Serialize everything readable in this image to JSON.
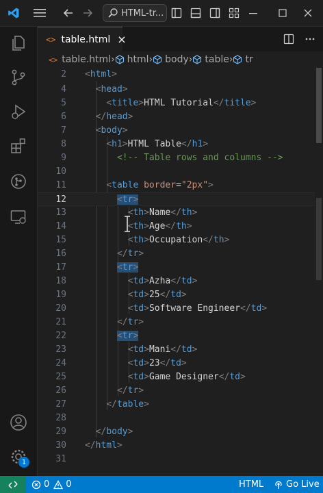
{
  "titlebar": {
    "search_text": "HTML-tr..."
  },
  "tab": {
    "label": "table.html",
    "close": "×"
  },
  "breadcrumbs": [
    "table.html",
    "html",
    "body",
    "table",
    "tr"
  ],
  "code_lines": [
    {
      "n": "2"
    },
    {
      "n": "4"
    },
    {
      "n": "5"
    },
    {
      "n": "6"
    },
    {
      "n": "7"
    },
    {
      "n": "8"
    },
    {
      "n": "9"
    },
    {
      "n": "10"
    },
    {
      "n": "11"
    },
    {
      "n": "12"
    },
    {
      "n": "13"
    },
    {
      "n": "14"
    },
    {
      "n": "15"
    },
    {
      "n": "16"
    },
    {
      "n": "17"
    },
    {
      "n": "18"
    },
    {
      "n": "19"
    },
    {
      "n": "20"
    },
    {
      "n": "21"
    },
    {
      "n": "22"
    },
    {
      "n": "23"
    },
    {
      "n": "24"
    },
    {
      "n": "25"
    },
    {
      "n": "26"
    },
    {
      "n": "27"
    },
    {
      "n": "28"
    },
    {
      "n": "29"
    },
    {
      "n": "30"
    },
    {
      "n": "31"
    }
  ],
  "code": {
    "title_text": "HTML Tutorial",
    "h1_text": "HTML Table",
    "comment": "<!-- Table rows and columns -->",
    "border_attr": "border",
    "border_val": "\"2px\"",
    "th": [
      "Name",
      "Age",
      "Occupation"
    ],
    "row1": [
      "Azha",
      "25",
      "Software Engineer"
    ],
    "row2": [
      "Mani",
      "23",
      "Game Designer"
    ]
  },
  "status": {
    "errors": "0",
    "warnings": "0",
    "language": "HTML",
    "golive": "Go Live",
    "badge": "1"
  },
  "colors": {
    "statusbar": "#007acc",
    "remote": "#16825d",
    "accent": "#0078d4"
  }
}
